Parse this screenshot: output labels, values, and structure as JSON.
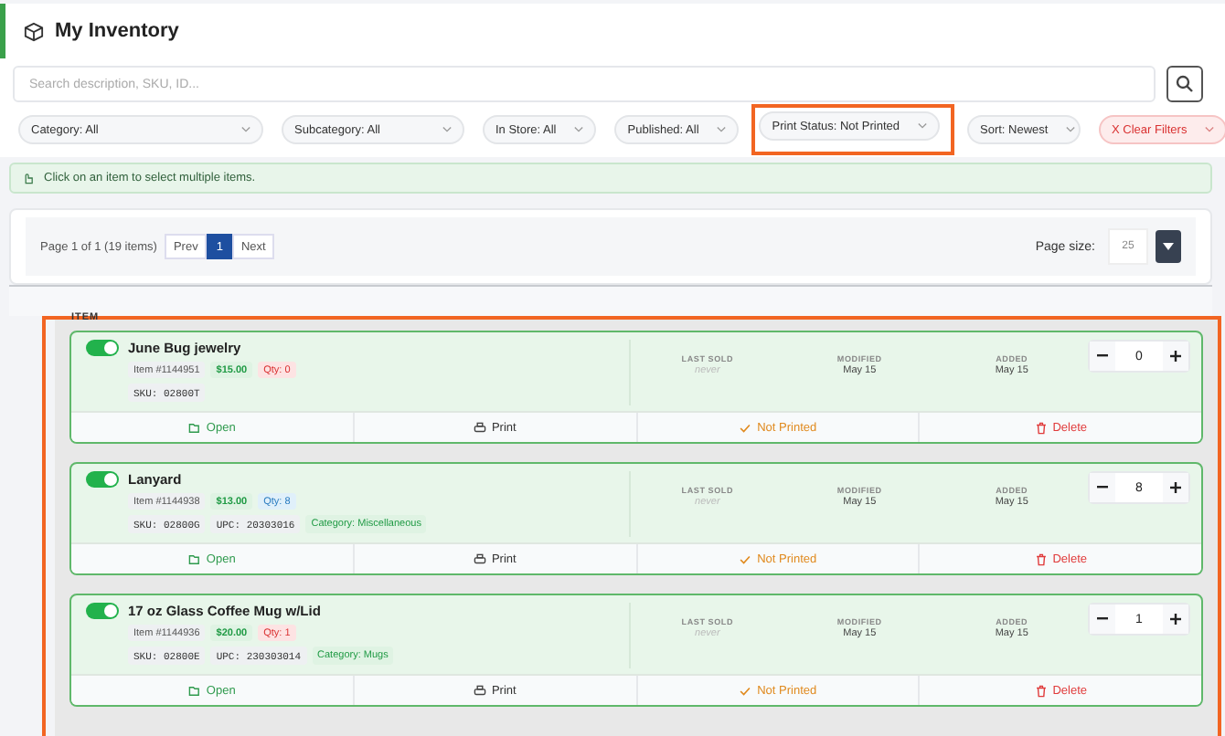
{
  "header": {
    "title": "My Inventory"
  },
  "search": {
    "placeholder": "Search description, SKU, ID..."
  },
  "filters": [
    {
      "label": "Category: All",
      "kind": "select",
      "highlighted": false
    },
    {
      "label": "Subcategory: All",
      "kind": "select",
      "highlighted": false
    },
    {
      "label": "In Store: All",
      "kind": "select",
      "highlighted": false
    },
    {
      "label": "Published: All",
      "kind": "select",
      "highlighted": false
    },
    {
      "label": "Print Status: Not Printed",
      "kind": "select",
      "highlighted": true
    },
    {
      "label": "Sort: Newest",
      "kind": "select",
      "highlighted": false
    },
    {
      "label": "X Clear Filters",
      "kind": "clear",
      "highlighted": false
    }
  ],
  "notice": "Click on an item to select multiple items.",
  "pagination": {
    "summary": "Page 1 of 1 (19 items)",
    "pages": [
      {
        "label": "Prev",
        "selected": false
      },
      {
        "label": "1",
        "selected": true
      },
      {
        "label": "Next",
        "selected": false
      }
    ],
    "page_size_label": "Page size:",
    "page_size": "25"
  },
  "table": {
    "column": "ITEM",
    "highlighted": true,
    "items": [
      {
        "name": "June Bug jewelry",
        "on": true,
        "item_no": "Item #1144951",
        "price": "$15.00",
        "qty": "Qty: 0",
        "qty_low": true,
        "tags": [
          {
            "text": "SKU: 02800T",
            "kind": "code"
          }
        ],
        "last_sold_label": "LAST SOLD",
        "last_sold": "never",
        "modified_label": "MODIFIED",
        "modified": "May 15",
        "added_label": "ADDED",
        "added": "May 15",
        "count": "0",
        "actions": [
          {
            "label": "Open",
            "kind": "open"
          },
          {
            "label": "Print",
            "kind": "print"
          },
          {
            "label": "Not Printed",
            "kind": "status"
          },
          {
            "label": "Delete",
            "kind": "delete"
          }
        ]
      },
      {
        "name": "Lanyard",
        "on": true,
        "item_no": "Item #1144938",
        "price": "$13.00",
        "qty": "Qty: 8",
        "qty_low": false,
        "tags": [
          {
            "text": "SKU: 02800G",
            "kind": "code"
          },
          {
            "text": "UPC: 20303016",
            "kind": "code"
          },
          {
            "text": "Category: Miscellaneous",
            "kind": "category"
          }
        ],
        "last_sold_label": "LAST SOLD",
        "last_sold": "never",
        "modified_label": "MODIFIED",
        "modified": "May 15",
        "added_label": "ADDED",
        "added": "May 15",
        "count": "8",
        "actions": [
          {
            "label": "Open",
            "kind": "open"
          },
          {
            "label": "Print",
            "kind": "print"
          },
          {
            "label": "Not Printed",
            "kind": "status"
          },
          {
            "label": "Delete",
            "kind": "delete"
          }
        ]
      },
      {
        "name": "17 oz Glass Coffee Mug w/Lid",
        "on": true,
        "item_no": "Item #1144936",
        "price": "$20.00",
        "qty": "Qty: 1",
        "qty_low": true,
        "tags": [
          {
            "text": "SKU: 02800E",
            "kind": "code"
          },
          {
            "text": "UPC: 230303014",
            "kind": "code"
          },
          {
            "text": "Category: Mugs",
            "kind": "category"
          }
        ],
        "last_sold_label": "LAST SOLD",
        "last_sold": "never",
        "modified_label": "MODIFIED",
        "modified": "May 15",
        "added_label": "ADDED",
        "added": "May 15",
        "count": "1",
        "actions": [
          {
            "label": "Open",
            "kind": "open"
          },
          {
            "label": "Print",
            "kind": "print"
          },
          {
            "label": "Not Printed",
            "kind": "status"
          },
          {
            "label": "Delete",
            "kind": "delete"
          }
        ]
      }
    ]
  }
}
